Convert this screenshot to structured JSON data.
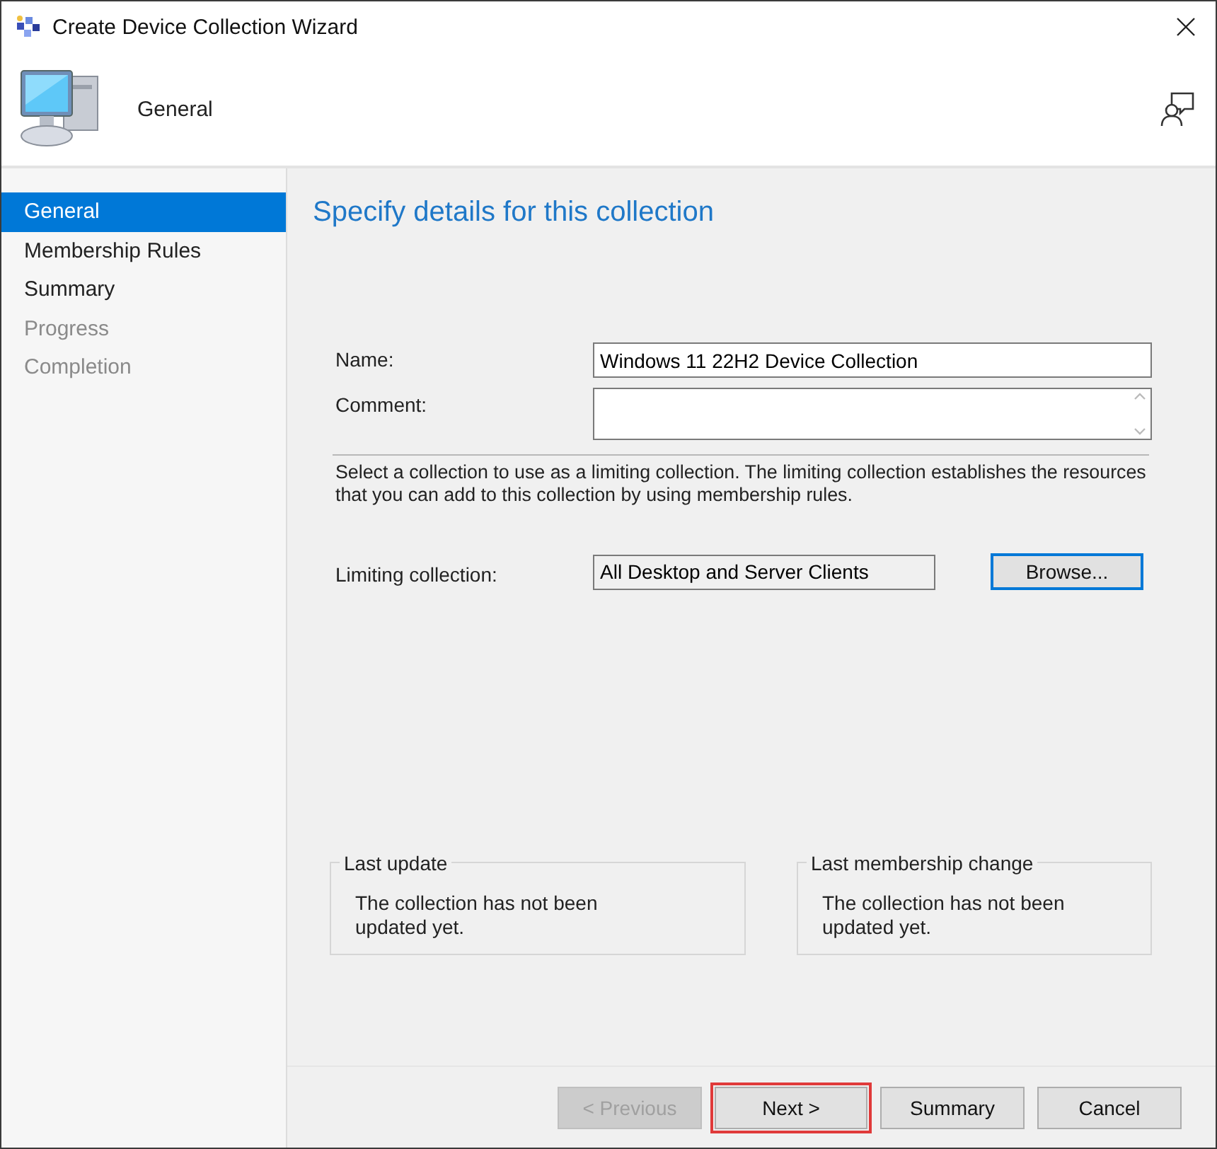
{
  "window": {
    "title": "Create Device Collection Wizard"
  },
  "header": {
    "title": "General"
  },
  "steps": [
    {
      "label": "General",
      "selected": true,
      "disabled": false
    },
    {
      "label": "Membership Rules",
      "selected": false,
      "disabled": false
    },
    {
      "label": "Summary",
      "selected": false,
      "disabled": false
    },
    {
      "label": "Progress",
      "selected": false,
      "disabled": true
    },
    {
      "label": "Completion",
      "selected": false,
      "disabled": true
    }
  ],
  "page": {
    "heading": "Specify details for this collection",
    "fields": [
      {
        "label": "Name:",
        "kind": "text",
        "value": "Windows 11 22H2 Device Collection"
      },
      {
        "label": "Comment:",
        "kind": "multiline"
      }
    ],
    "description": "Select a collection to use as a limiting collection. The limiting collection establishes the resources that you can add to this collection by using membership rules.",
    "limiting": {
      "label": "Limiting collection:",
      "value": "All Desktop and Server Clients",
      "button": {
        "label": "Browse...",
        "focused": true
      }
    },
    "groups": [
      {
        "title": "Last update",
        "text": "The collection has not been updated yet."
      },
      {
        "title": "Last membership change",
        "text": "The collection has not been updated yet."
      }
    ]
  },
  "buttons": [
    {
      "label": "< Previous",
      "disabled": true,
      "highlighted": false
    },
    {
      "label": "Next >",
      "disabled": false,
      "highlighted": true
    },
    {
      "label": "Summary",
      "disabled": false,
      "highlighted": false
    },
    {
      "label": "Cancel",
      "disabled": false,
      "highlighted": false
    }
  ]
}
